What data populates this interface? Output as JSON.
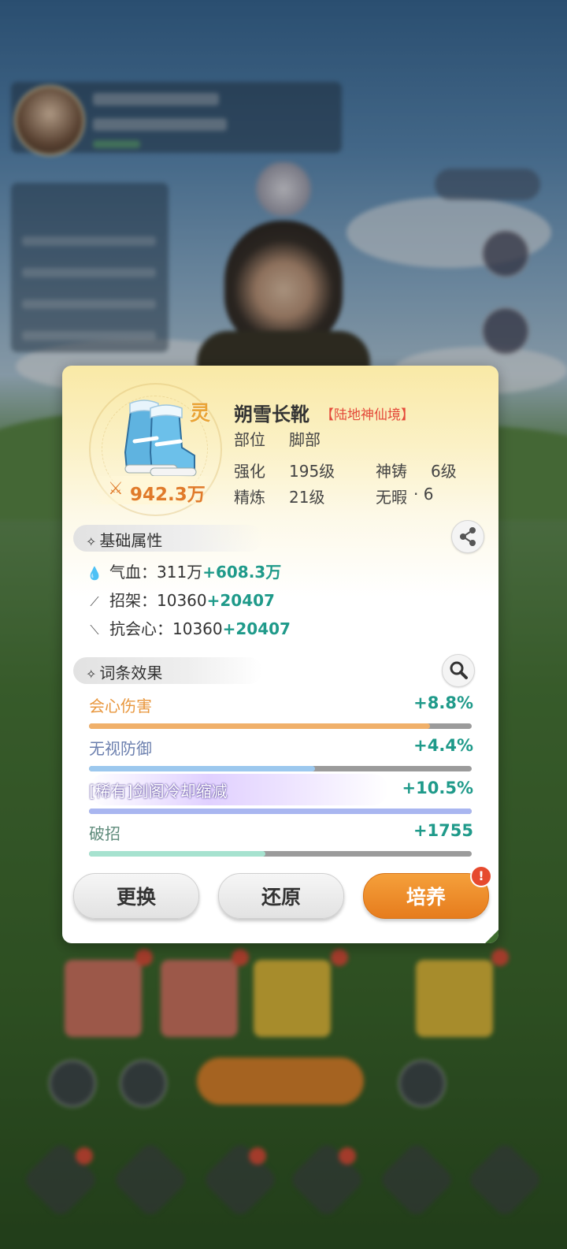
{
  "item": {
    "name": "朔雪长靴",
    "realm": "【陆地神仙境】",
    "quality_badge": "灵",
    "power": "942.3万",
    "slot_label": "部位",
    "slot_value": "脚部",
    "enhance_label": "强化",
    "enhance_value": "195级",
    "forge_label": "神铸",
    "forge_value": "6级",
    "refine_label": "精炼",
    "refine_value": "21级",
    "flawless_label": "无暇",
    "flawless_value": "· 6"
  },
  "base_section": {
    "title": "基础属性",
    "share_icon": "share-icon",
    "attrs": [
      {
        "icon": "droplet-icon",
        "label": "气血：",
        "base": "311万",
        "bonus": "+608.3万"
      },
      {
        "icon": "parry-icon",
        "label": "招架：",
        "base": "10360",
        "bonus": "+20407"
      },
      {
        "icon": "anti-crit-icon",
        "label": "抗会心：",
        "base": "10360",
        "bonus": "+20407"
      }
    ]
  },
  "affix_section": {
    "title": "词条效果",
    "search_icon": "magnifier-icon",
    "affixes": [
      {
        "name": "会心伤害",
        "value": "+8.8%",
        "fill": 0.89,
        "color": "#e8973e",
        "bar": "#f0b06a"
      },
      {
        "name": "无视防御",
        "value": "+4.4%",
        "fill": 0.59,
        "color": "#6b7fae",
        "bar": "#9cc8ee"
      },
      {
        "name": "[稀有]剑阁冷却缩减",
        "value": "+10.5%",
        "fill": 1.0,
        "color": "#ffffff",
        "bar": "#a9b6f0"
      },
      {
        "name": "破招",
        "value": "+1755",
        "fill": 0.46,
        "color": "#5d8a7a",
        "bar": "#a6e2cf"
      }
    ]
  },
  "buttons": {
    "replace": "更换",
    "restore": "还原",
    "train": "培养",
    "train_alert": "!"
  },
  "colors": {
    "accent_orange": "#e67c1d",
    "bonus_green": "#1f9a8a",
    "realm_red": "#e44a3a"
  }
}
